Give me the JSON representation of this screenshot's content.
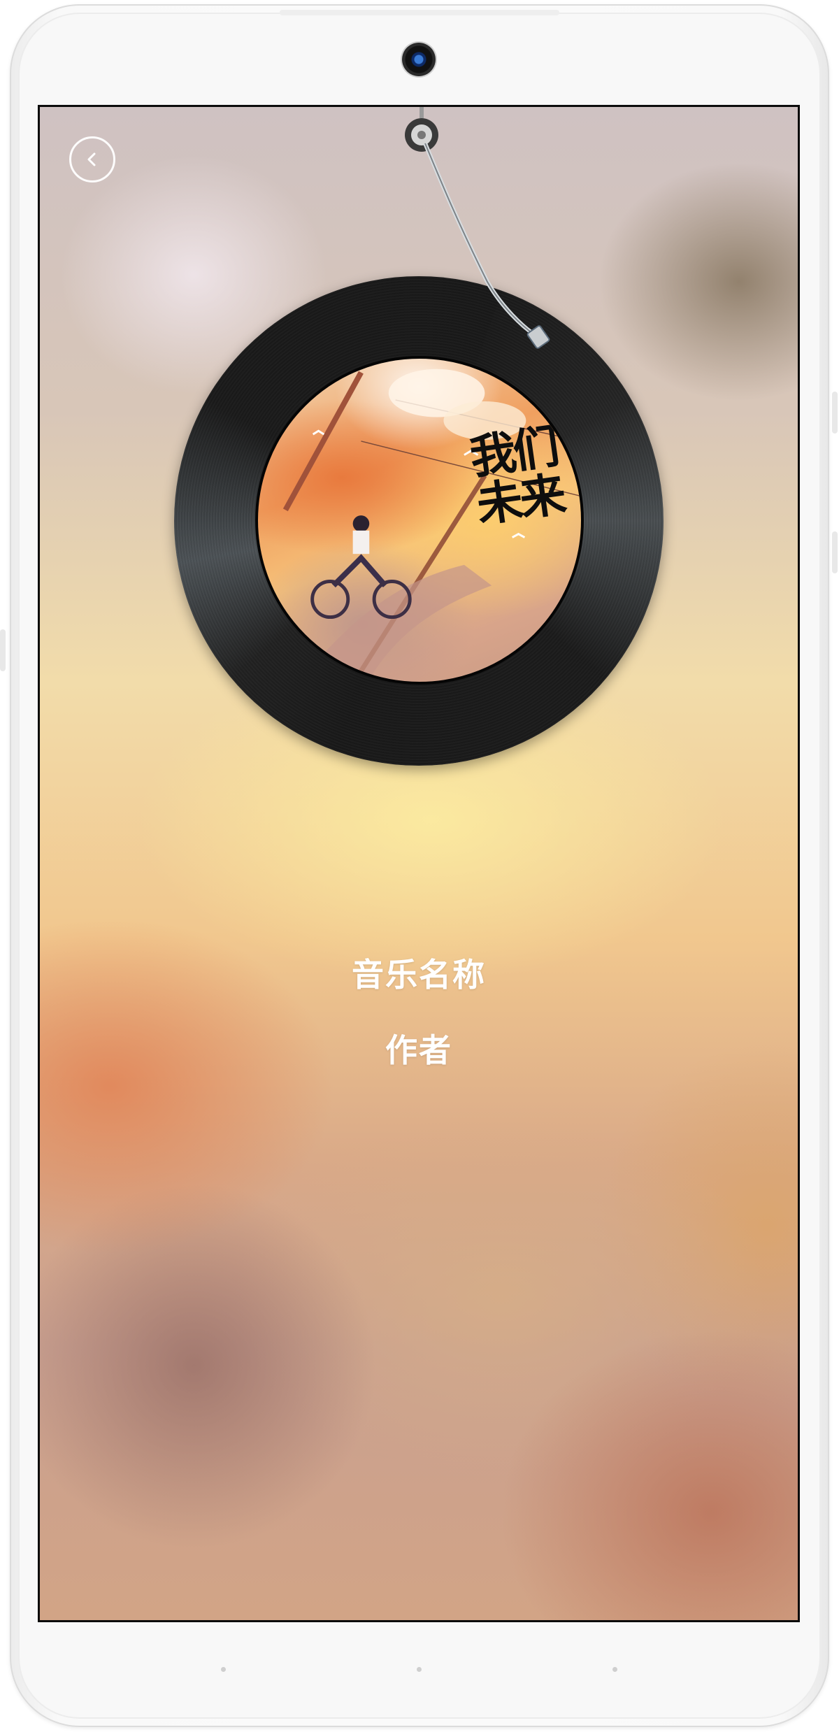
{
  "player": {
    "back_icon": "chevron-left-icon",
    "album_art": {
      "lettering": "我们未来"
    },
    "song_title": "音乐名称",
    "artist": "作者"
  },
  "colors": {
    "record": "#1b1b1b",
    "text": "#ffffff"
  }
}
